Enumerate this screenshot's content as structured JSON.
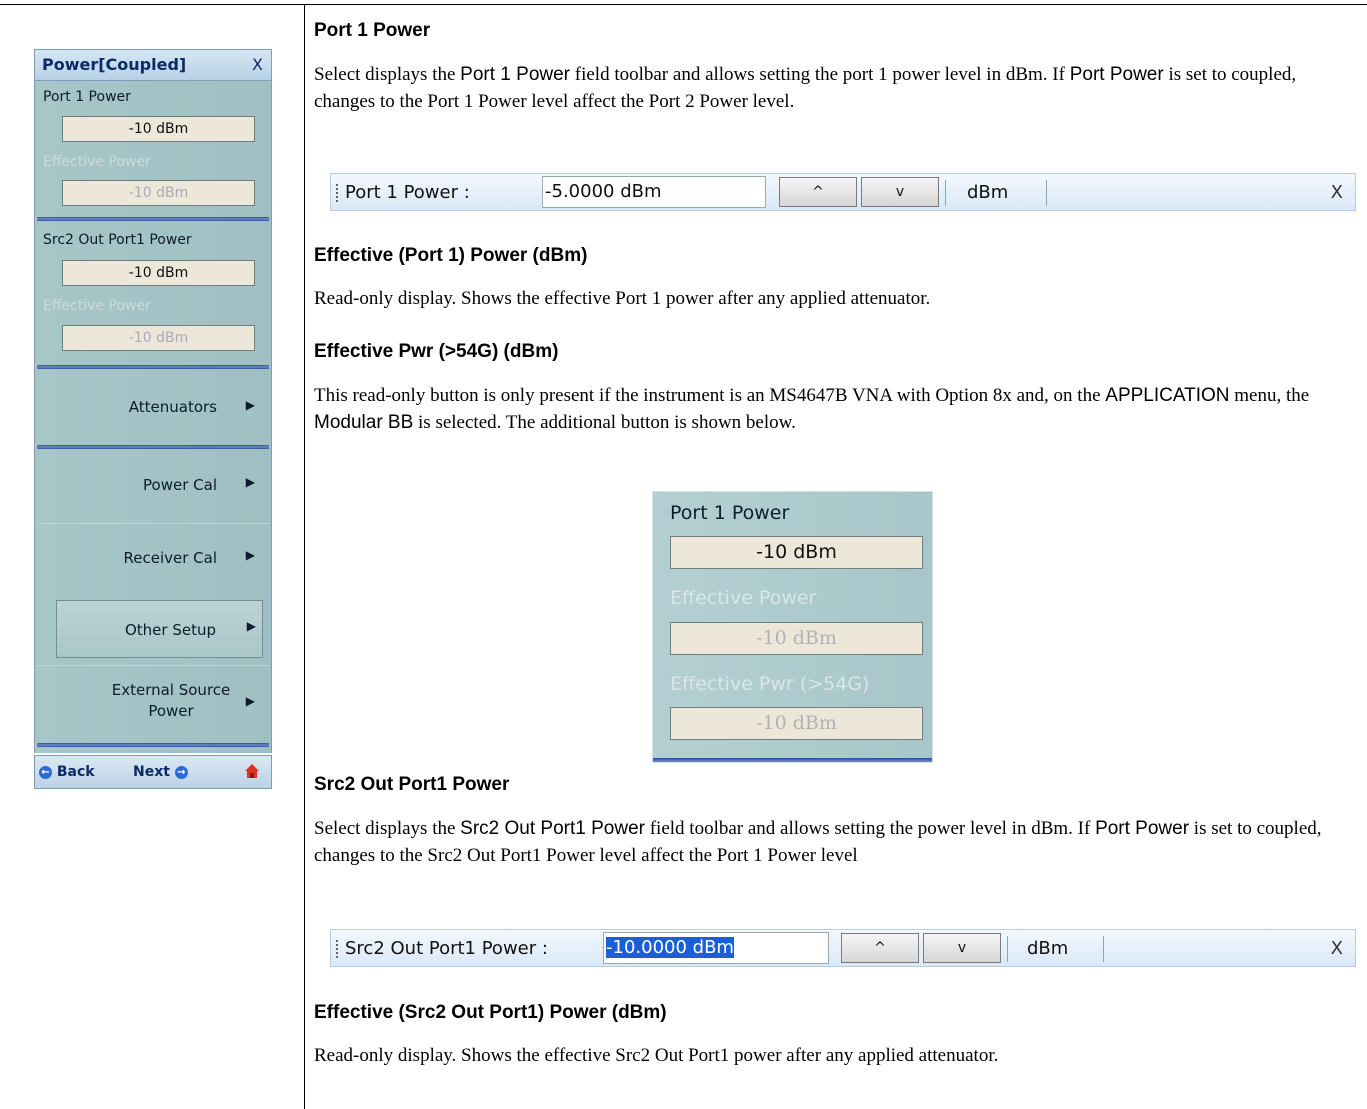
{
  "panel": {
    "title": "Power[Coupled]",
    "close": "X",
    "port1_label": "Port 1 Power",
    "port1_value": "-10  dBm",
    "eff1_label": "Effective Power",
    "eff1_value": "-10  dBm",
    "src2_label": "Src2 Out Port1 Power",
    "src2_value": "-10  dBm",
    "eff2_label": "Effective Power",
    "eff2_value": "-10  dBm",
    "buttons": [
      "Attenuators",
      "Power Cal",
      "Receiver Cal",
      "Other  Setup",
      "External Source Power"
    ],
    "back": "Back",
    "next": "Next"
  },
  "doc": {
    "h1": "Port 1 Power",
    "p1": [
      "Select displays the ",
      "Port 1 Power",
      " field toolbar and allows setting the port 1 power level in dBm. If ",
      "Port Power",
      " is set to coupled, changes to the Port 1 Power level affect the Port 2 Power level."
    ],
    "tb1": {
      "label": "Port 1 Power  :",
      "value": "-5.0000  dBm",
      "up": "^",
      "down": "v",
      "unit": "dBm",
      "close": "X"
    },
    "h2": "Effective (Port 1) Power (dBm)",
    "p2": "Read-only display. Shows the effective Port 1 power after any applied attenuator.",
    "h3": "Effective Pwr (>54G) (dBm)",
    "p3": [
      "This read-only button is only present if the instrument is an MS4647B VNA with Option 8x and, on the ",
      "APPLICATION",
      " menu, the ",
      "Modular BB",
      " is selected. The additional button is shown below."
    ],
    "shot": {
      "l1": "Port 1 Power",
      "v1": "-10  dBm",
      "l2": "Effective Power",
      "v2": "-10  dBm",
      "l3": "Effective Pwr (>54G)",
      "v3": "-10  dBm"
    },
    "h4": "Src2 Out Port1 Power",
    "p4": [
      "Select displays the ",
      "Src2 Out Port1 Power",
      " field toolbar and allows setting the power level in dBm. If ",
      "Port Power",
      " is set to coupled, changes to the Src2 Out Port1 Power level affect the Port 1 Power level"
    ],
    "tb2": {
      "label": "Src2 Out Port1 Power  :",
      "value": "-10.0000  dBm",
      "up": "^",
      "down": "v",
      "unit": "dBm",
      "close": "X"
    },
    "h5": "Effective (Src2 Out Port1) Power (dBm)",
    "p5": "Read-only display. Shows the effective Src2 Out Port1 power after any applied attenuator."
  }
}
